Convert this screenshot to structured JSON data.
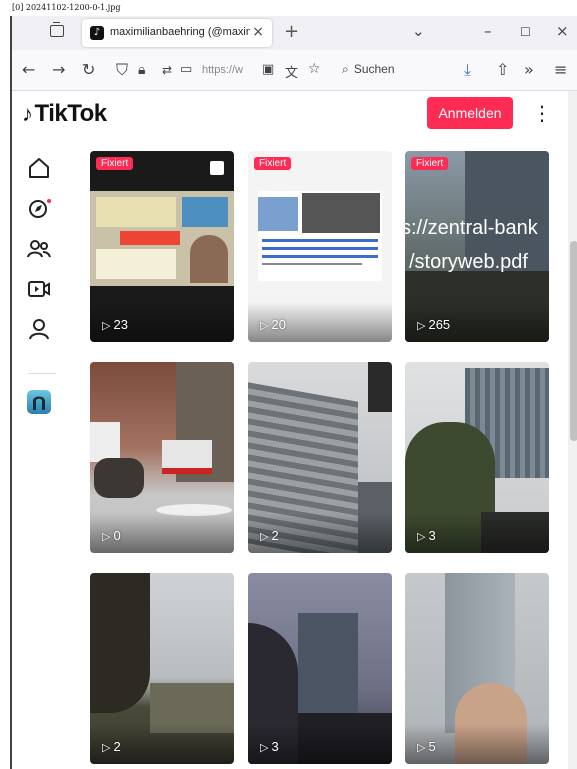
{
  "caption": "[0] 20241102-1200-0-1.jpg",
  "browser": {
    "tab_title": "maximilianbaehring (@maximil",
    "url_text": "https://w",
    "search_label": "Suchen"
  },
  "header": {
    "logo_text": "TikTok",
    "login_label": "Anmelden"
  },
  "sidebar": {
    "items": [
      "home-icon",
      "explore-icon",
      "following-icon",
      "live-icon",
      "profile-icon",
      "avatar"
    ]
  },
  "videos": [
    {
      "pinned": true,
      "badge": "Fixiert",
      "views": "23"
    },
    {
      "pinned": true,
      "badge": "Fixiert",
      "views": "20"
    },
    {
      "pinned": true,
      "badge": "Fixiert",
      "views": "265",
      "overlay_line1": "s://zentral-bank",
      "overlay_line2": "/storyweb.pdf"
    },
    {
      "pinned": false,
      "views": "0"
    },
    {
      "pinned": false,
      "views": "2"
    },
    {
      "pinned": false,
      "views": "3"
    },
    {
      "pinned": false,
      "views": "2"
    },
    {
      "pinned": false,
      "views": "3"
    },
    {
      "pinned": false,
      "views": "5"
    }
  ],
  "colors": {
    "accent": "#fe2c55"
  }
}
